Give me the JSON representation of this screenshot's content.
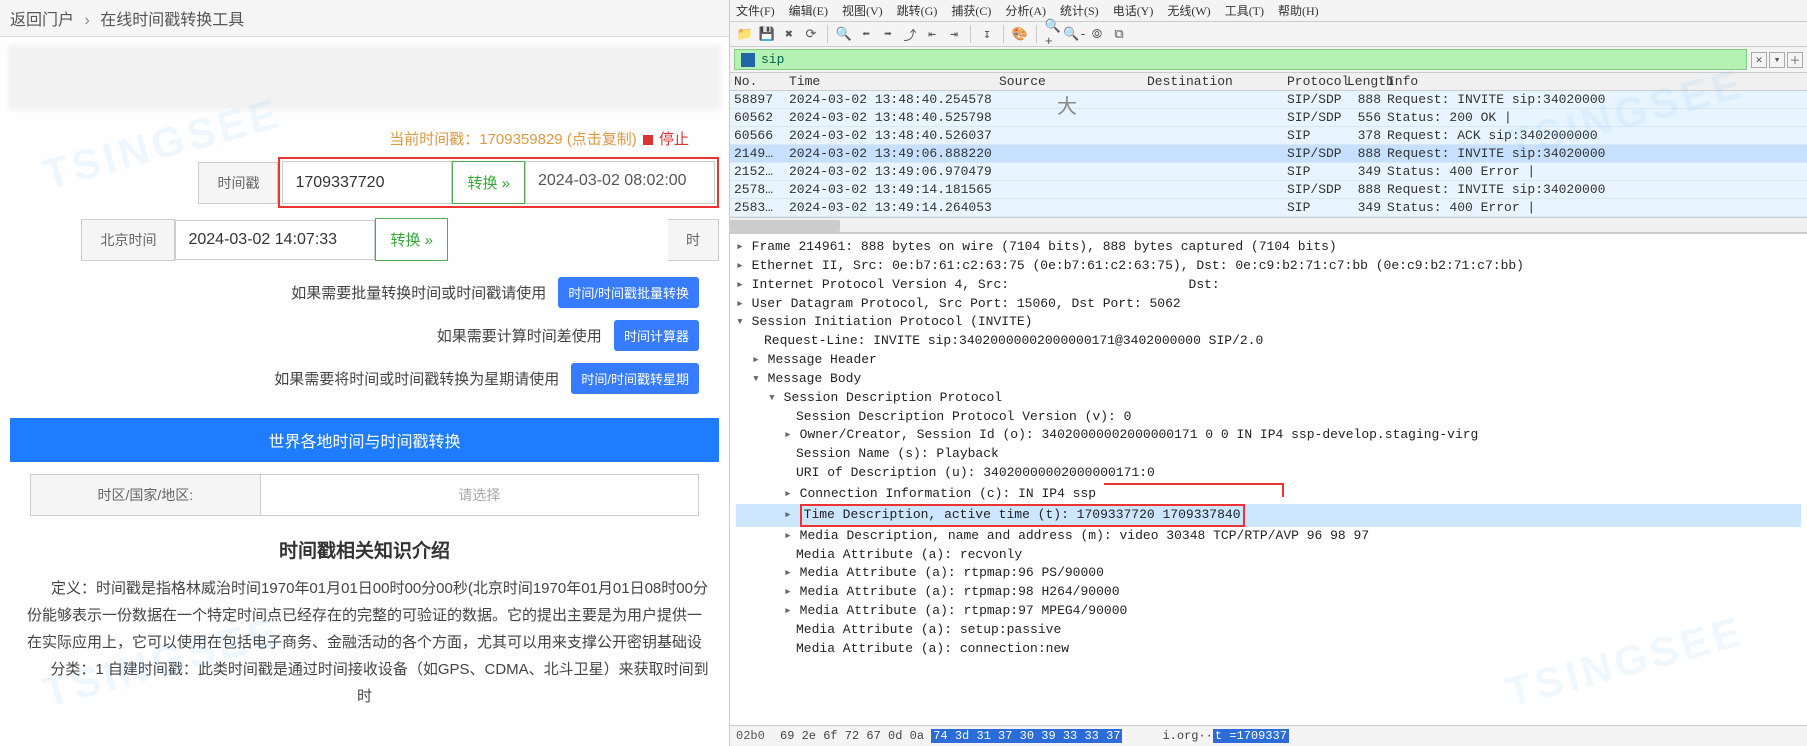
{
  "left": {
    "breadcrumb": {
      "back": "返回门户",
      "title": "在线时间戳转换工具"
    },
    "current": {
      "label": "当前时间戳：",
      "value": "1709359829",
      "hint": "(点击复制)",
      "stop": "停止"
    },
    "row1": {
      "lbl": "时间戳",
      "input": "1709337720",
      "btn": "转换 »",
      "out": "2024-03-02 08:02:00"
    },
    "row2": {
      "lbl": "北京时间",
      "input": "2024-03-02 14:07:33",
      "btn": "转换 »",
      "out_lbl": "时"
    },
    "help1": {
      "text": "如果需要批量转换时间或时间戳请使用",
      "btn": "时间/时间戳批量转换"
    },
    "help2": {
      "text": "如果需要计算时间差使用",
      "btn": "时间计算器"
    },
    "help3": {
      "text": "如果需要将时间或时间戳转换为星期请使用",
      "btn": "时间/时间戳转星期"
    },
    "section_title": "世界各地时间与时间戳转换",
    "tz": {
      "lbl": "时区/国家/地区:",
      "placeholder": "请选择"
    },
    "intro_title": "时间戳相关知识介绍",
    "intro_p1": "定义：时间戳是指格林威治时间1970年01月01日00时00分00秒(北京时间1970年01月01日08时00分",
    "intro_p2": "份能够表示一份数据在一个特定时间点已经存在的完整的可验证的数据。它的提出主要是为用户提供一",
    "intro_p3": "在实际应用上，它可以使用在包括电子商务、金融活动的各个方面，尤其可以用来支撑公开密钥基础设",
    "intro_p4": "分类：1 自建时间戳：此类时间戳是通过时间接收设备（如GPS、CDMA、北斗卫星）来获取时间到时",
    "big_char": "大"
  },
  "right": {
    "menu": [
      "文件(F)",
      "编辑(E)",
      "视图(V)",
      "跳转(G)",
      "捕获(C)",
      "分析(A)",
      "统计(S)",
      "电话(Y)",
      "无线(W)",
      "工具(T)",
      "帮助(H)"
    ],
    "filter": "sip",
    "cols": {
      "no": "No.",
      "time": "Time",
      "src": "Source",
      "dst": "Destination",
      "pro": "Protocol",
      "len": "Length",
      "info": "Info"
    },
    "packets": [
      {
        "no": "58897",
        "time": "2024-03-02 13:48:40.254578",
        "src": "",
        "dst": "",
        "pro": "SIP/SDP",
        "len": "888",
        "info": "Request: INVITE sip:34020000"
      },
      {
        "no": "60562",
        "time": "2024-03-02 13:48:40.525798",
        "src": "",
        "dst": "",
        "pro": "SIP/SDP",
        "len": "556",
        "info": "Status: 200 OK |"
      },
      {
        "no": "60566",
        "time": "2024-03-02 13:48:40.526037",
        "src": "",
        "dst": "",
        "pro": "SIP",
        "len": "378",
        "info": "Request: ACK sip:3402000000"
      },
      {
        "no": "2149…",
        "time": "2024-03-02 13:49:06.888220",
        "src": "",
        "dst": "",
        "pro": "SIP/SDP",
        "len": "888",
        "info": "Request: INVITE sip:34020000"
      },
      {
        "no": "2152…",
        "time": "2024-03-02 13:49:06.970479",
        "src": "",
        "dst": "",
        "pro": "SIP",
        "len": "349",
        "info": "Status: 400 Error |"
      },
      {
        "no": "2578…",
        "time": "2024-03-02 13:49:14.181565",
        "src": "",
        "dst": "",
        "pro": "SIP/SDP",
        "len": "888",
        "info": "Request: INVITE sip:34020000"
      },
      {
        "no": "2583…",
        "time": "2024-03-02 13:49:14.264053",
        "src": "",
        "dst": "",
        "pro": "SIP",
        "len": "349",
        "info": "Status: 400 Error |"
      }
    ],
    "details": {
      "frame": "Frame 214961: 888 bytes on wire (7104 bits), 888 bytes captured (7104 bits)",
      "eth": "Ethernet II, Src: 0e:b7:61:c2:63:75 (0e:b7:61:c2:63:75), Dst: 0e:c9:b2:71:c7:bb (0e:c9:b2:71:c7:bb)",
      "ip": "Internet Protocol Version 4, Src:                       Dst: ",
      "udp": "User Datagram Protocol, Src Port: 15060, Dst Port: 5062",
      "sip": "Session Initiation Protocol (INVITE)",
      "reqline": "Request-Line: INVITE sip:34020000002000000171@3402000000 SIP/2.0",
      "msghdr": "Message Header",
      "msgbody": "Message Body",
      "sdp": "Session Description Protocol",
      "sdp_v": "Session Description Protocol Version (v): 0",
      "sdp_o": "Owner/Creator, Session Id (o): 34020000002000000171 0 0 IN IP4 ssp-develop.staging-virg",
      "sdp_s": "Session Name (s): Playback",
      "sdp_u": "URI of Description (u): 34020000002000000171:0",
      "sdp_c": "Connection Information (c): IN IP4 ssp",
      "sdp_t": "Time Description, active time (t): 1709337720 1709337840",
      "sdp_m": "Media Description, name and address (m): video 30348 TCP/RTP/AVP 96 98 97",
      "attr_recv": "Media Attribute (a): recvonly",
      "attr_96": "Media Attribute (a): rtpmap:96 PS/90000",
      "attr_98": "Media Attribute (a): rtpmap:98 H264/90000",
      "attr_97": "Media Attribute (a): rtpmap:97 MPEG4/90000",
      "attr_setup": "Media Attribute (a): setup:passive",
      "attr_conn": "Media Attribute (a): connection:new"
    },
    "hex": {
      "addr": "02b0",
      "pre": "69 2e 6f 72 67 0d 0a ",
      "sel": "74  3d 31 37 30 39 33 33 37",
      "ascii_pre": "i.org··",
      "ascii_sel": "t =1709337"
    }
  }
}
